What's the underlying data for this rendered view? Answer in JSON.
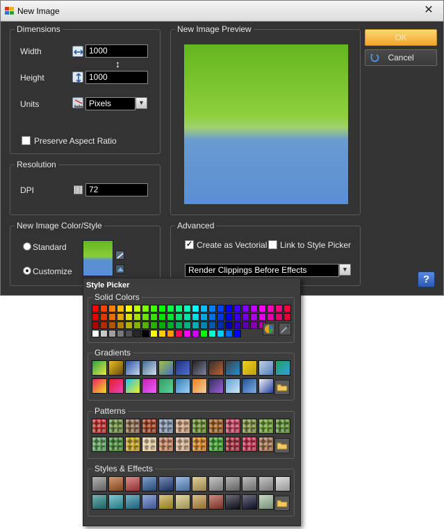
{
  "window": {
    "title": "New Image"
  },
  "dimensions": {
    "title": "Dimensions",
    "width_label": "Width",
    "width_value": "1000",
    "height_label": "Height",
    "height_value": "1000",
    "units_label": "Units",
    "units_value": "Pixels",
    "preserve_label": "Preserve Aspect Ratio",
    "preserve_checked": false
  },
  "resolution": {
    "title": "Resolution",
    "dpi_label": "DPI",
    "dpi_value": "72"
  },
  "color_style": {
    "title": "New Image Color/Style",
    "standard_label": "Standard",
    "customize_label": "Customize",
    "selected": "Customize"
  },
  "preview": {
    "title": "New Image Preview",
    "top_color": "#63b61f",
    "bottom_color": "#5b8fd4"
  },
  "advanced": {
    "title": "Advanced",
    "vectorial_label": "Create as Vectorial",
    "vectorial_checked": true,
    "link_label": "Link to Style Picker",
    "link_checked": false,
    "render_value": "Render Clippings Before Effects"
  },
  "buttons": {
    "ok": "OK",
    "cancel": "Cancel",
    "help": "?"
  },
  "style_picker": {
    "title": "Style Picker",
    "solid_title": "Solid Colors",
    "gradients_title": "Gradients",
    "patterns_title": "Patterns",
    "styles_title": "Styles & Effects",
    "solid_rows": [
      [
        "#ff0000",
        "#ff4000",
        "#ff8000",
        "#ffbf00",
        "#ffff00",
        "#bfff00",
        "#80ff00",
        "#40ff00",
        "#00ff00",
        "#00ff40",
        "#00ff80",
        "#00ffbf",
        "#00ffff",
        "#00bfff",
        "#0080ff",
        "#0040ff",
        "#0000ff",
        "#4000ff",
        "#8000ff",
        "#bf00ff",
        "#ff00ff",
        "#ff00bf",
        "#ff0080",
        "#ff0040"
      ],
      [
        "#e00000",
        "#e03800",
        "#e07000",
        "#e0a800",
        "#e0e000",
        "#a8e000",
        "#70e000",
        "#38e000",
        "#00e000",
        "#00e038",
        "#00e070",
        "#00e0a8",
        "#00e0e0",
        "#00a8e0",
        "#0070e0",
        "#0038e0",
        "#0000e0",
        "#3800e0",
        "#7000e0",
        "#a800e0",
        "#e000e0",
        "#e000a8",
        "#e00070",
        "#e00038"
      ],
      [
        "#b00000",
        "#b02c00",
        "#b05800",
        "#b08400",
        "#b0b000",
        "#84b000",
        "#58b000",
        "#2cb000",
        "#00b000",
        "#00b02c",
        "#00b058",
        "#00b084",
        "#00b0b0",
        "#0084b0",
        "#0058b0",
        "#002cb0",
        "#0000b0",
        "#2c00b0",
        "#5800b0",
        "#8400b0",
        "#b000b0"
      ],
      [
        "#ffffff",
        "#c8c8c8",
        "#a0a0a0",
        "#787878",
        "#505050",
        "#282828",
        "#000000",
        "#ffff00",
        "#ffcc00",
        "#ff9900",
        "#ff0066",
        "#ff00ff",
        "#cc00ff",
        "#00ff00",
        "#00ffcc",
        "#00ccff",
        "#0066ff",
        "#0000ff"
      ]
    ],
    "gradients": [
      [
        "#2aa14a,#e8e840",
        "#e8c020,#6a4a10",
        "#3050a0,#c0d8f0",
        "#406890,#d0e0f0",
        "#a0c040,#4070c0",
        "#203080,#5070d0",
        "#202020,#8080a0",
        "#303030,#c06030",
        "#404040,#2090d0",
        "#f0d020,#c0a010",
        "#c0d0e0,#5080c0",
        "#20a060,#30a0e0"
      ],
      [
        "#f02060,#f0e020",
        "#e02020,#f040c0",
        "#20c0f0,#f0f020",
        "#c020c0,#f060f0",
        "#30a060,#60d0a0",
        "#3080c0,#a0d0f0",
        "#f08020,#f0d0a0",
        "#303060,#a060d0",
        "#60a0e0,#d0e8f0",
        "#2050a0,#80b0e0",
        "#f0f0f0,#2040a0"
      ]
    ],
    "patterns": [
      [
        "#c03030",
        "#6a8a40",
        "#8a6a50",
        "#a04020",
        "#8090a8",
        "#c8a080",
        "#6a8a30",
        "#a06020",
        "#c04060",
        "#7a8a40",
        "#6a9a30",
        "#5a8a30"
      ],
      [
        "#5a9a5a",
        "#4a8a3a",
        "#c0a020",
        "#e0c8a0",
        "#c08060",
        "#d0b090",
        "#d08020",
        "#40a030",
        "#a03040",
        "#c03050",
        "#a07050"
      ]
    ],
    "styles": [
      [
        "#808080",
        "#b05a20",
        "#c04040",
        "#3060a0",
        "#204080",
        "#6090d0",
        "#c8b060",
        "#a0a0a0",
        "#808080",
        "#909090",
        "#a0a0a0",
        "#c8c8c8"
      ],
      [
        "#208080",
        "#30a0b0",
        "#2080a0",
        "#5070c0",
        "#c0a030",
        "#d0c070",
        "#c09040",
        "#a04030",
        "#101020",
        "#101030",
        "#a0c0a0"
      ]
    ]
  }
}
